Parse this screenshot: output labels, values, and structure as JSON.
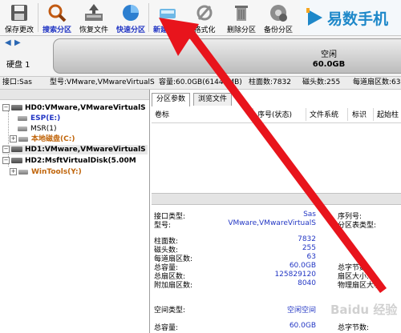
{
  "toolbar": {
    "buttons": [
      {
        "label": "保存更改",
        "icon": "save-icon"
      },
      {
        "label": "搜索分区",
        "icon": "search-icon"
      },
      {
        "label": "恢复文件",
        "icon": "recover-icon"
      },
      {
        "label": "快速分区",
        "icon": "quick-partition-icon"
      },
      {
        "label": "新建分区",
        "icon": "new-partition-icon"
      },
      {
        "label": "格式化",
        "icon": "format-icon"
      },
      {
        "label": "删除分区",
        "icon": "delete-icon"
      },
      {
        "label": "备份分区",
        "icon": "backup-icon"
      }
    ],
    "brand": "易数手机"
  },
  "disk_strip": {
    "disk_label": "硬盘 1",
    "bar_title": "空闲",
    "bar_size": "60.0GB"
  },
  "info_line": {
    "interface": "接口:Sas",
    "model": "型号:VMware,VMwareVirtualS",
    "capacity": "容量:60.0GB(61440MB)",
    "cylinders": "柱面数:7832",
    "heads": "磁头数:255",
    "sectors": "每道扇区数:63"
  },
  "tree": {
    "items": [
      {
        "text": "HD0:VMware,VMwareVirtualS"
      },
      {
        "text": "ESP(E:)"
      },
      {
        "text": "MSR(1)"
      },
      {
        "text": "本地磁盘(C:)"
      },
      {
        "text": "HD1:VMware,VMwareVirtualS"
      },
      {
        "text": "HD2:MsftVirtualDisk(5.00M"
      },
      {
        "text": "WinTools(Y:)"
      }
    ]
  },
  "tabs": [
    {
      "label": "分区参数",
      "active": true
    },
    {
      "label": "浏览文件",
      "active": false
    }
  ],
  "table": {
    "columns": [
      "卷标",
      "序号(状态)",
      "文件系统",
      "标识",
      "起始柱"
    ]
  },
  "details": {
    "interface_type_label": "接口类型:",
    "interface_type_value": "Sas",
    "model_label": "型号:",
    "model_value": "VMware,VMwareVirtualS",
    "serial_label": "序列号:",
    "partition_table_label": "分区表类型:",
    "cylinders_label": "柱面数:",
    "cylinders_value": "7832",
    "heads_label": "磁头数:",
    "heads_value": "255",
    "sectors_label": "每道扇区数:",
    "sectors_value": "63",
    "capacity_label": "总容量:",
    "capacity_value": "60.0GB",
    "total_bytes_label": "总字节数:",
    "total_sectors_label": "总扇区数:",
    "total_sectors_value": "125829120",
    "sector_size_label": "扇区大小:",
    "extra_sectors_label": "附加扇区数:",
    "extra_sectors_value": "8040",
    "physical_sector_label": "物理扇区大小:",
    "free_space_type_label": "空间类型:",
    "free_space_type_value": "空闲空间",
    "free_capacity_label": "总容量:",
    "free_capacity_value": "60.0GB",
    "free_bytes_label": "总字节数:"
  },
  "colors": {
    "annotation_arrow": "#e8141c",
    "value_blue": "#2236c4",
    "brand_blue": "#1e88c9"
  }
}
